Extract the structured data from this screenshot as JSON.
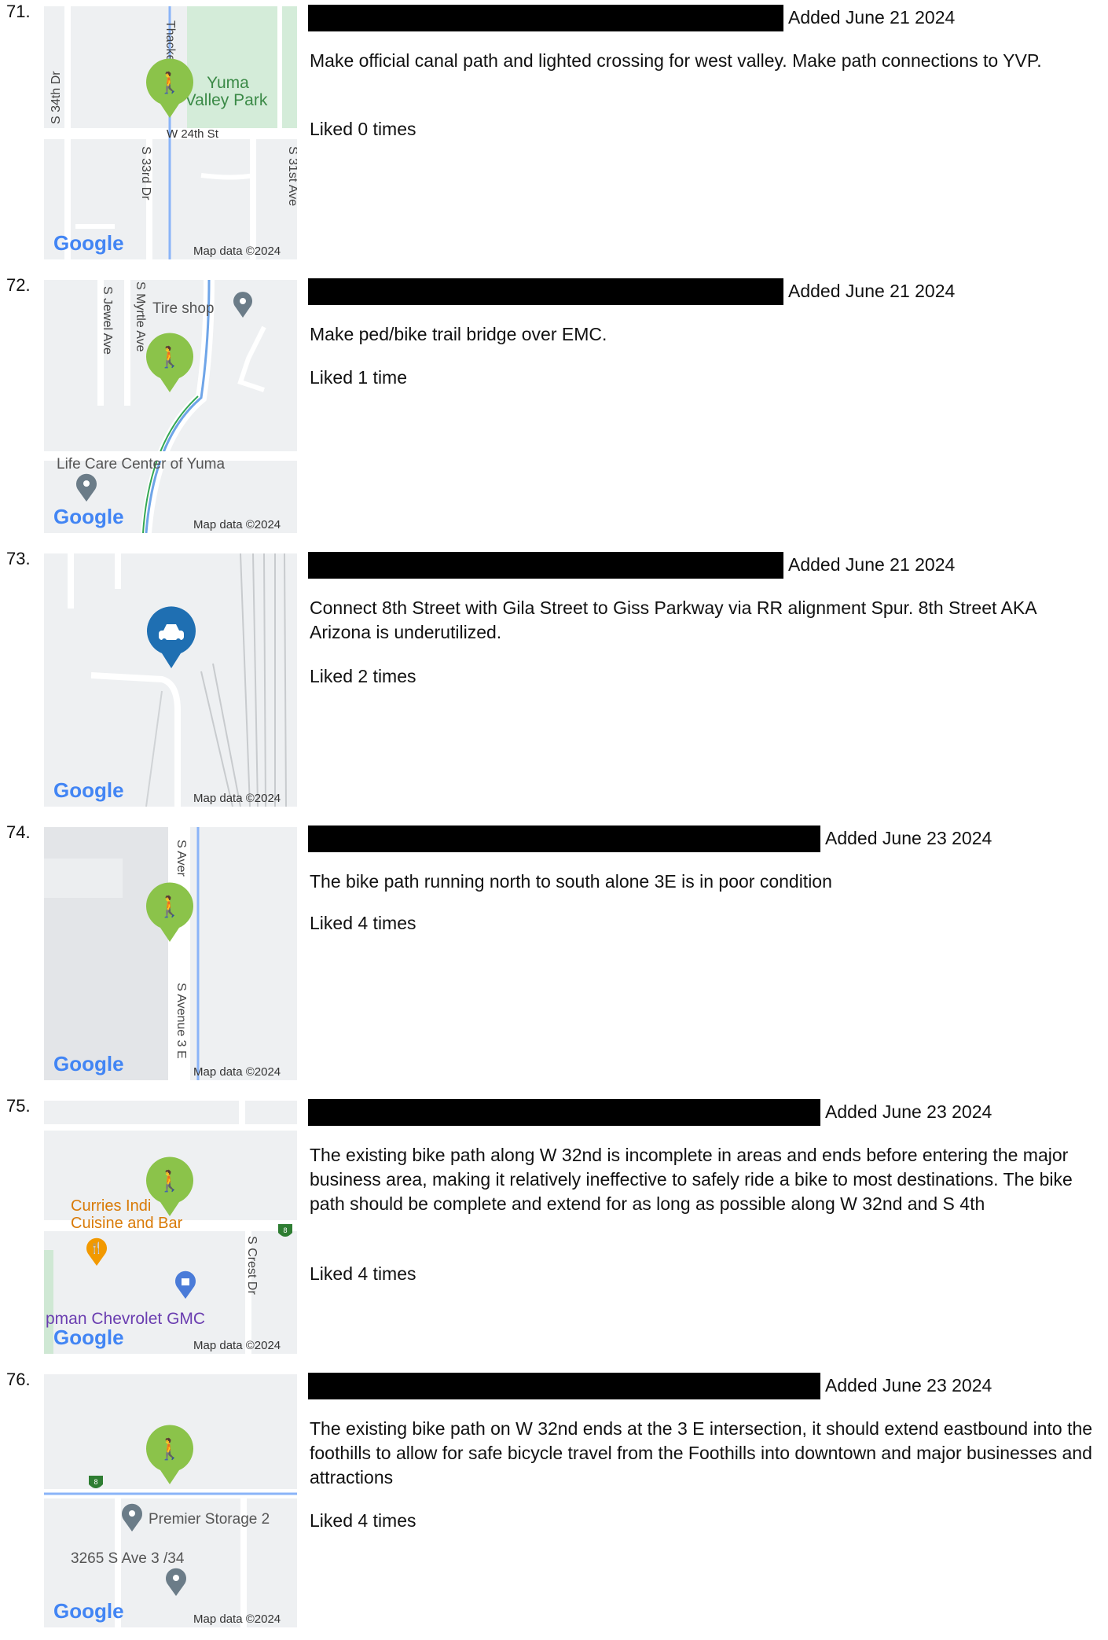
{
  "entries": [
    {
      "number": "71.",
      "added": "Added June 21 2024",
      "description": "Make official canal path and lighted crossing for west valley. Make path connections to YVP.",
      "likes": "Liked 0 times",
      "pin_icon": "pedestrian-bicycle-icon",
      "pin_color": "#8bc34a"
    },
    {
      "number": "72.",
      "added": "Added June 21 2024",
      "description": "Make ped/bike trail bridge over EMC.",
      "likes": "Liked 1 time",
      "pin_icon": "pedestrian-bicycle-icon",
      "pin_color": "#8bc34a"
    },
    {
      "number": "73.",
      "added": "Added June 21 2024",
      "description": "Connect 8th Street with Gila Street to Giss Parkway via RR alignment Spur. 8th Street AKA Arizona is underutilized.",
      "likes": "Liked 2 times",
      "pin_icon": "car-icon",
      "pin_color": "#1f6fb2"
    },
    {
      "number": "74.",
      "added": "Added June 23 2024",
      "description": "The bike path running north to south alone 3E is in poor condition",
      "likes": "Liked 4 times",
      "pin_icon": "pedestrian-bicycle-icon",
      "pin_color": "#8bc34a"
    },
    {
      "number": "75.",
      "added": "Added June 23 2024",
      "description": "The existing bike path along W 32nd is incomplete in areas and ends before entering the major business area, making it relatively ineffective to safely ride a bike to most destinations. The bike path should be complete and extend for as long as possible along W 32nd and S 4th",
      "likes": "Liked 4 times",
      "pin_icon": "pedestrian-bicycle-icon",
      "pin_color": "#8bc34a"
    },
    {
      "number": "76.",
      "added": "Added June 23 2024",
      "description": "The existing bike path on W 32nd ends at the 3 E intersection, it should extend eastbound into the foothills to allow for safe bicycle travel from the Foothills into downtown and major businesses and attractions",
      "likes": "Liked 4 times",
      "pin_icon": "pedestrian-bicycle-icon",
      "pin_color": "#8bc34a"
    }
  ],
  "maps": {
    "google": "Google",
    "map_data": "Map data ©2024",
    "m71": {
      "s34": "S 34th Dr",
      "thacker": "Thacke",
      "yuma": "Yuma",
      "valley_park": "Valley Park",
      "w24": "W 24th St",
      "s33": "S 33rd Dr",
      "s31": "S 31st Ave"
    },
    "m72": {
      "jewel": "S Jewel Ave",
      "myrtle": "S Myrtle Ave",
      "tire": "Tire shop",
      "lifecare": "Life Care Center of Yuma"
    },
    "m74": {
      "avenue_top": "S Aver",
      "avenue_bottom": "S Avenue 3 E"
    },
    "m75": {
      "curries1": "Curries Indi",
      "curries2": "Cuisine and Bar",
      "crest": "S Crest Dr",
      "chevy": "pman Chevrolet GMC",
      "shield": "8"
    },
    "m76": {
      "premier": "Premier Storage 2",
      "address": "3265 S Ave 3 /34",
      "shield": "8"
    }
  }
}
